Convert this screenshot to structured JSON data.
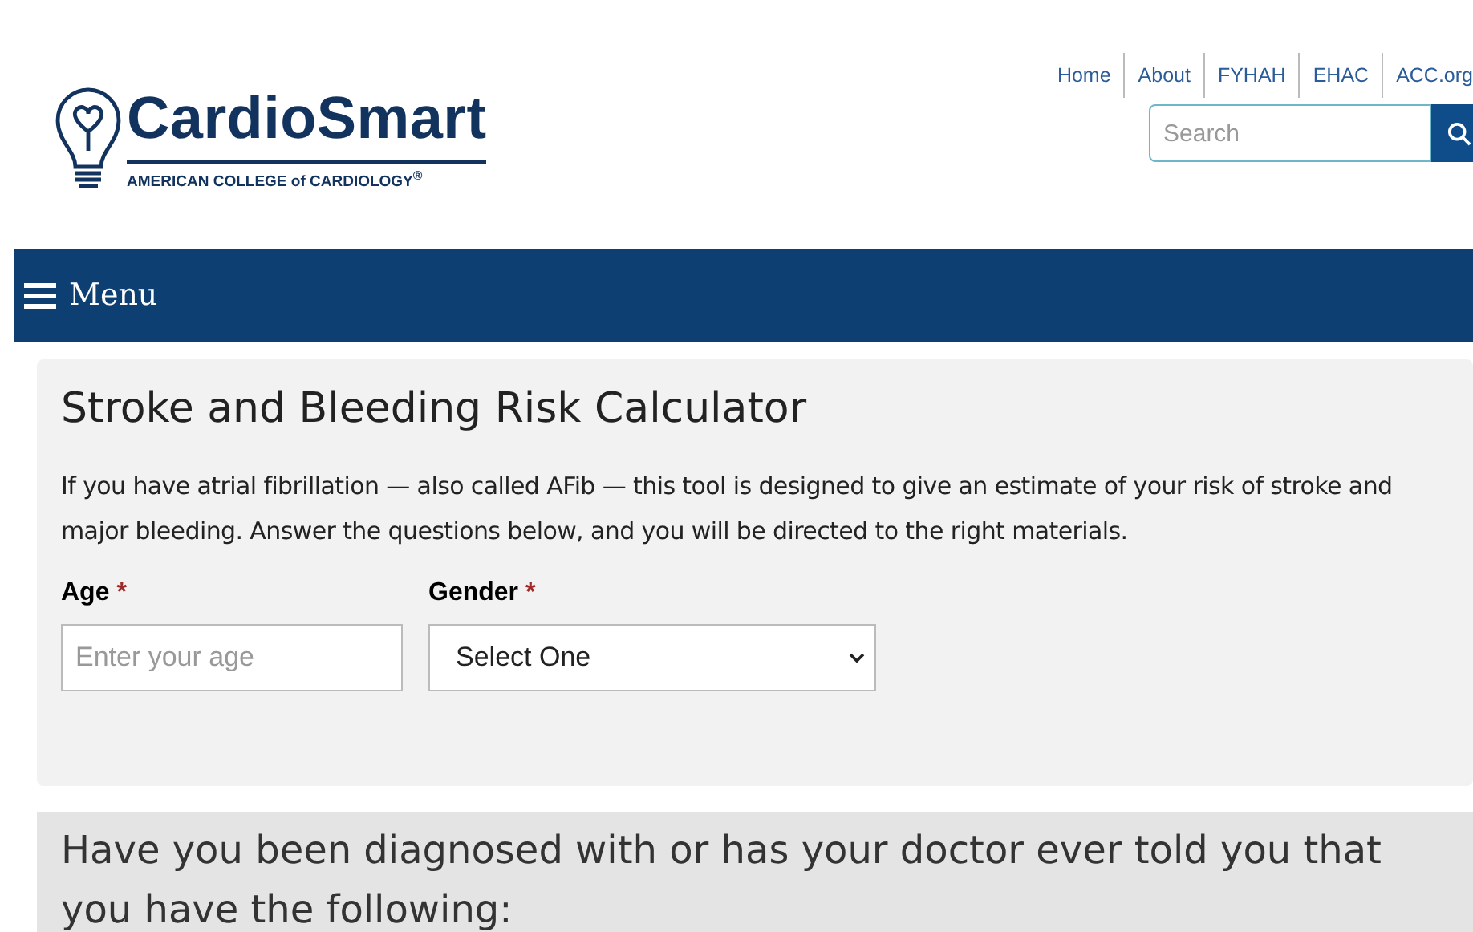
{
  "logo": {
    "name": "CardioSmart",
    "subtitle": "AMERICAN COLLEGE of CARDIOLOGY$^{®}$"
  },
  "top_links": [
    {
      "label": "Home"
    },
    {
      "label": "About"
    },
    {
      "label": "FYHAH"
    },
    {
      "label": "EHAC"
    },
    {
      "label": "ACC.org"
    }
  ],
  "search": {
    "placeholder": "Search"
  },
  "menu": {
    "label": "Menu"
  },
  "calculator": {
    "title": "Stroke and Bleeding Risk Calculator",
    "intro": "If you have atrial fibrillation — also called AFib — this tool is designed to give an estimate of your risk of stroke and major bleeding. Answer the questions below, and you will be directed to the right materials.",
    "fields": [
      {
        "label": "Age",
        "required": "*",
        "kind": "input",
        "placeholder": "Enter your age"
      },
      {
        "label": "Gender",
        "required": "*",
        "kind": "select",
        "value": "Select One"
      }
    ]
  },
  "question": {
    "text": "Have you been diagnosed with or has your doctor ever told you that you have the following:"
  }
}
